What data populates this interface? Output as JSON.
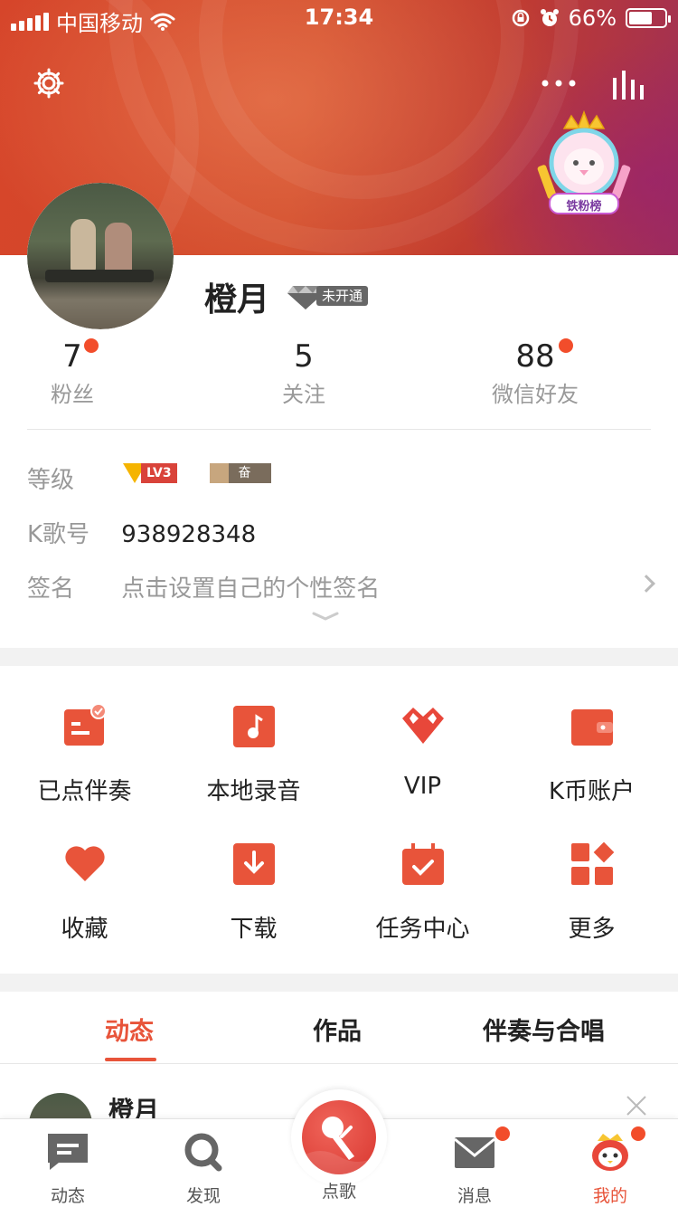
{
  "status_bar": {
    "carrier": "中国移动",
    "time": "17:34",
    "battery": "66%",
    "battery_level": 0.66
  },
  "profile": {
    "name": "橙月",
    "vip_status": "未开通",
    "stats": [
      {
        "value": "7",
        "label": "粉丝",
        "dot": true
      },
      {
        "value": "5",
        "label": "关注",
        "dot": false
      },
      {
        "value": "88",
        "label": "微信好友",
        "dot": true
      }
    ],
    "level_label": "等级",
    "level_badge": "LV3",
    "level_status": "奋斗中",
    "kid_label": "K歌号",
    "kid_value": "938928348",
    "signature_label": "签名",
    "signature_hint": "点击设置自己的个性签名",
    "fan_badge_label": "铁粉榜"
  },
  "grid": [
    {
      "label": "已点伴奏",
      "icon": "ordered-accompaniment-icon"
    },
    {
      "label": "本地录音",
      "icon": "local-recording-icon"
    },
    {
      "label": "VIP",
      "icon": "vip-diamond-icon"
    },
    {
      "label": "K币账户",
      "icon": "wallet-icon"
    },
    {
      "label": "收藏",
      "icon": "heart-icon"
    },
    {
      "label": "下载",
      "icon": "download-icon"
    },
    {
      "label": "任务中心",
      "icon": "calendar-check-icon"
    },
    {
      "label": "更多",
      "icon": "more-grid-icon"
    }
  ],
  "tabs": [
    {
      "label": "动态",
      "active": true
    },
    {
      "label": "作品",
      "active": false
    },
    {
      "label": "伴奏与合唱",
      "active": false
    }
  ],
  "feed": {
    "name": "橙月"
  },
  "tabbar": [
    {
      "label": "动态",
      "icon": "chat-icon"
    },
    {
      "label": "发现",
      "icon": "search-icon"
    },
    {
      "label": "点歌",
      "icon": "microphone-icon"
    },
    {
      "label": "消息",
      "icon": "mail-icon",
      "dot": true
    },
    {
      "label": "我的",
      "icon": "mascot-icon",
      "dot": true,
      "active": true
    }
  ],
  "colors": {
    "accent": "#e8543a",
    "red_dot": "#f24d2b",
    "header_start": "#d6452a",
    "header_end": "#9f2f56"
  }
}
